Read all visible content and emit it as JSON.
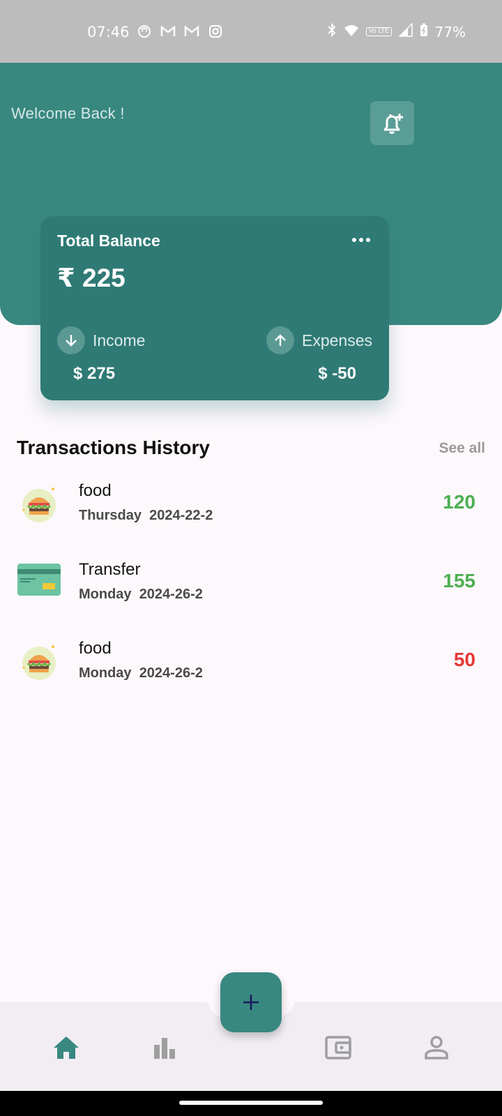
{
  "status_bar": {
    "time": "07:46",
    "notification_icons": [
      "face-icon",
      "gmail-icon",
      "gmail-icon",
      "instagram-icon"
    ],
    "system_icons": [
      "bluetooth-icon",
      "wifi-icon",
      "volte-icon",
      "signal-icon",
      "battery-icon"
    ],
    "volte_label": "Vo LTE",
    "battery": "77%"
  },
  "header": {
    "welcome": "Welcome Back  !",
    "bell_icon": "bell-plus-icon",
    "color": "#388880"
  },
  "balance_card": {
    "title": "Total Balance",
    "more_icon": "more-horizontal-icon",
    "amount": "₹ 225",
    "income_label": "Income",
    "income_value": "$ 275",
    "expenses_label": "Expenses",
    "expenses_value": "$ -50",
    "color": "#2f7a75"
  },
  "transactions": {
    "title": "Transactions History",
    "see_all": "See all",
    "items": [
      {
        "name": "food",
        "day": "Thursday",
        "date": "2024-22-2",
        "amount": "120",
        "icon": "burger-icon",
        "amount_color": "#4caf50"
      },
      {
        "name": "Transfer",
        "day": "Monday",
        "date": "2024-26-2",
        "amount": "155",
        "icon": "credit-card-icon",
        "amount_color": "#4caf50"
      },
      {
        "name": "food",
        "day": "Monday",
        "date": "2024-26-2",
        "amount": "50",
        "icon": "burger-icon",
        "amount_color": "#e53935"
      }
    ]
  },
  "bottom_nav": {
    "items": [
      "home-icon",
      "bar-chart-icon",
      "wallet-icon",
      "person-icon"
    ],
    "active": "home-icon",
    "fab_icon": "plus-icon"
  }
}
